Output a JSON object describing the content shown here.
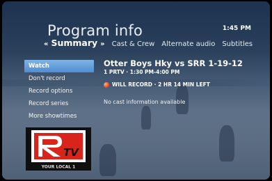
{
  "header": {
    "title": "Program info",
    "clock": "1:45 PM"
  },
  "tabs": {
    "left_arrow": "«",
    "active": "Summary",
    "right_arrow": "»",
    "others": [
      "Cast & Crew",
      "Alternate audio",
      "Subtitles"
    ]
  },
  "menu": {
    "items": [
      {
        "label": "Watch",
        "selected": true
      },
      {
        "label": "Don't record",
        "selected": false
      },
      {
        "label": "Record options",
        "selected": false
      },
      {
        "label": "Record series",
        "selected": false
      },
      {
        "label": "More showtimes",
        "selected": false
      }
    ]
  },
  "program": {
    "title": "Otter Boys Hky vs SRR 1-19-12",
    "subtitle": "1 PRTV · 1:30 PM-4:00 PM",
    "record_status": "WILL RECORD · 2 HR 14 MIN LEFT",
    "cast_info": "No cast information available"
  },
  "logo": {
    "letters": "RTV",
    "tagline": "YOUR LOCAL 1"
  },
  "colors": {
    "selected_item": "#5f9cdb",
    "record_dot": "#e5502a",
    "logo_red": "#d9241c"
  }
}
